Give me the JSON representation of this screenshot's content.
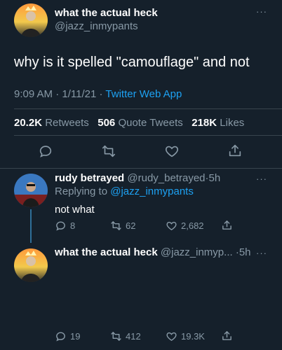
{
  "main_tweet": {
    "display_name": "what the actual heck",
    "handle": "@jazz_inmypants",
    "text": "why is it spelled \"camouflage\" and not",
    "time": "9:09 AM",
    "date_sep": "·",
    "date": "1/11/21",
    "client_sep": "·",
    "client": "Twitter Web App",
    "retweets_count": "20.2K",
    "retweets_label": "Retweets",
    "quote_count": "506",
    "quote_label": "Quote Tweets",
    "likes_count": "218K",
    "likes_label": "Likes",
    "more": "···"
  },
  "reply_1": {
    "display_name": "rudy betrayed",
    "handle": "@rudy_betrayed",
    "sep": "·",
    "age": "5h",
    "replying_prefix": "Replying to",
    "replying_to": "@jazz_inmypants",
    "text": "not what",
    "reply_count": "8",
    "retweet_count": "62",
    "like_count": "2,682",
    "more": "···"
  },
  "reply_2": {
    "display_name": "what the actual heck",
    "handle": "@jazz_inmyp...",
    "sep": "·",
    "age": "5h",
    "reply_count": "19",
    "retweet_count": "412",
    "like_count": "19.3K",
    "more": "···"
  },
  "colors": {
    "background": "#15202b",
    "accent": "#1da1f2",
    "muted": "#8899a6",
    "divider": "#38444d"
  }
}
